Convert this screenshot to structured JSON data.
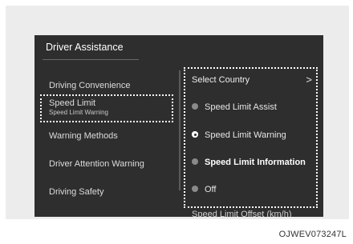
{
  "screen_title": "Driver Assistance",
  "left_menu": [
    {
      "label": "Driving Convenience"
    },
    {
      "label": "Speed Limit",
      "sublabel": "Speed Limit Warning"
    },
    {
      "label": "Warning Methods"
    },
    {
      "label": "Driver Attention Warning"
    },
    {
      "label": "Driving Safety"
    }
  ],
  "right_panel": {
    "header": "Select Country",
    "chevron": ">",
    "options": [
      {
        "label": "Speed Limit Assist",
        "selected": false
      },
      {
        "label": "Speed Limit Warning",
        "selected": true
      },
      {
        "label": "Speed Limit Information",
        "selected": false
      },
      {
        "label": "Off",
        "selected": false
      }
    ],
    "partial_next_item": "Speed Limit Offset (km/h)"
  },
  "image_code": "OJWEV073247L"
}
